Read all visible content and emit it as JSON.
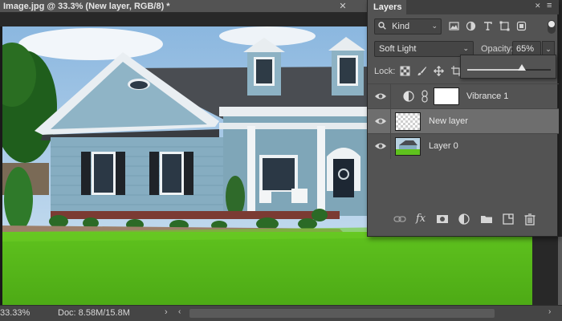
{
  "document": {
    "title": "Image.jpg @ 33.3% (New layer, RGB/8) *",
    "close_glyph": "✕"
  },
  "status_bar": {
    "zoom": "33.33%",
    "doc_size": "Doc: 8.58M/15.8M",
    "arrow_glyph": "›",
    "scroll_left_glyph": "‹",
    "scroll_right_glyph": "›"
  },
  "layers_panel": {
    "tab_label": "Layers",
    "close_glyph": "✕",
    "menu_glyph": "≡",
    "filter": {
      "kind_icon": "search-icon",
      "kind_label": "Kind",
      "chevron": "⌄",
      "icons": [
        "image-filter-icon",
        "adjustment-filter-icon",
        "type-filter-icon",
        "shape-filter-icon",
        "smart-object-filter-icon"
      ]
    },
    "blend_mode": "Soft Light",
    "blend_chevron": "⌄",
    "opacity_label": "Opacity:",
    "opacity_value": "65%",
    "opacity_dropdown_glyph": "⌄",
    "opacity_slider_fraction": 0.65,
    "lock_label": "Lock:",
    "lock_icons": [
      "lock-transparent-pixels-icon",
      "lock-image-pixels-icon",
      "lock-position-icon",
      "lock-artboard-icon"
    ],
    "layers": [
      {
        "name": "Vibrance 1",
        "type": "adjustment",
        "visible": true,
        "selected": false
      },
      {
        "name": "New layer",
        "type": "pixel-transparent",
        "visible": true,
        "selected": true
      },
      {
        "name": "Layer 0",
        "type": "pixel-image",
        "visible": true,
        "selected": false
      }
    ],
    "footer_icons": [
      "link-layers-icon",
      "fx-icon",
      "add-mask-icon",
      "new-adjustment-icon",
      "new-group-icon",
      "new-layer-icon",
      "delete-layer-icon"
    ],
    "fx_label": "fx"
  },
  "colors": {
    "panel_bg": "#535353",
    "selected_row": "#6e6e6e",
    "workspace": "#282828"
  }
}
